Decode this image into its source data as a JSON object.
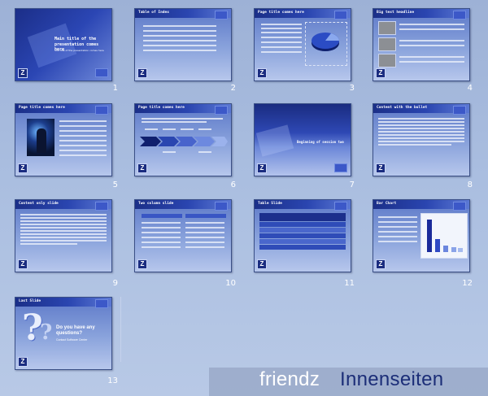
{
  "slides": [
    {
      "num": "1",
      "title": "Main title of the presentation comes here",
      "subtitle": "Sub title of the presentation comes here"
    },
    {
      "num": "2",
      "title": "Table of Index"
    },
    {
      "num": "3",
      "title": "Page title comes here"
    },
    {
      "num": "4",
      "title": "Big text headline"
    },
    {
      "num": "5",
      "title": "Page title comes here"
    },
    {
      "num": "6",
      "title": "Page title comes here"
    },
    {
      "num": "7",
      "title": "Beginning of session two"
    },
    {
      "num": "8",
      "title": "Content with the bullet"
    },
    {
      "num": "9",
      "title": "Content only slide"
    },
    {
      "num": "10",
      "title": "Two column slide"
    },
    {
      "num": "11",
      "title": "Table Slide"
    },
    {
      "num": "12",
      "title": "Bar Chart"
    },
    {
      "num": "13",
      "title": "Last Slide",
      "question": "Do you have any questions?",
      "contact": "Contact Software Center"
    }
  ],
  "banner": {
    "word1": "friendz",
    "word2": "Innenseiten"
  },
  "colors": {
    "header": "#1b2f88",
    "slide_bg": "#8aa3dc",
    "page_bg": "#aabee0",
    "banner_text": "#1c2e78"
  },
  "icons": {
    "logo": "z-logo-icon",
    "question": "question-marks-icon",
    "person": "person-touchscreen-image",
    "pie": "pie-chart-icon",
    "arrows": "process-arrows-icon"
  }
}
